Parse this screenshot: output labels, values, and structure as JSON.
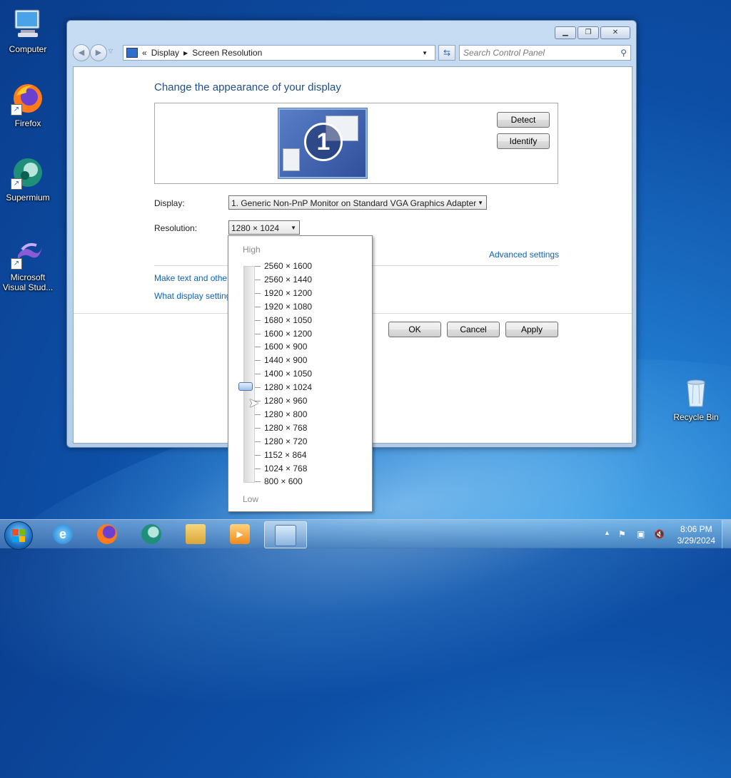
{
  "desktop": {
    "icons": [
      {
        "label": "Computer"
      },
      {
        "label": "Firefox"
      },
      {
        "label": "Supermium"
      },
      {
        "label": "Microsoft Visual Stud..."
      },
      {
        "label": "Recycle Bin"
      }
    ]
  },
  "window": {
    "caption_buttons": [
      "minimize",
      "restore",
      "close"
    ],
    "breadcrumb": {
      "prefix": "«",
      "items": [
        "Display",
        "Screen Resolution"
      ]
    },
    "search_placeholder": "Search Control Panel",
    "title": "Change the appearance of your display",
    "monitor_number": "1",
    "detect_label": "Detect",
    "identify_label": "Identify",
    "display_label": "Display:",
    "display_value": "1. Generic Non-PnP Monitor on Standard VGA Graphics Adapter",
    "resolution_label": "Resolution:",
    "resolution_value": "1280 × 1024",
    "advanced_settings": "Advanced settings",
    "link_text_size": "Make text and other",
    "link_display_settings": "What display setting",
    "ok_label": "OK",
    "cancel_label": "Cancel",
    "apply_label": "Apply"
  },
  "resolution_dropdown": {
    "high_label": "High",
    "low_label": "Low",
    "options": [
      "2560 × 1600",
      "2560 × 1440",
      "1920 × 1200",
      "1920 × 1080",
      "1680 × 1050",
      "1600 × 1200",
      "1600 × 900",
      "1440 × 900",
      "1400 × 1050",
      "1280 × 1024",
      "1280 × 960",
      "1280 × 800",
      "1280 × 768",
      "1280 × 720",
      "1152 × 864",
      "1024 × 768",
      "800 × 600"
    ],
    "selected": "1280 × 1024"
  },
  "taskbar": {
    "apps": [
      "Start",
      "Internet Explorer",
      "Firefox",
      "Supermium",
      "Windows Explorer",
      "Media Player",
      "Control Panel"
    ],
    "active_app": "Control Panel",
    "time": "8:06 PM",
    "date": "3/29/2024"
  },
  "colors": {
    "accent": "#1e4e8c",
    "link": "#0e62b8"
  }
}
